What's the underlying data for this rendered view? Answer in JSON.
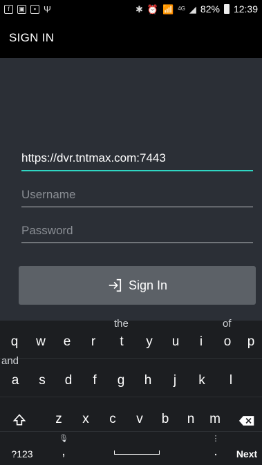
{
  "status_bar": {
    "battery": "82%",
    "time": "12:39",
    "signal_label": "4G"
  },
  "app_bar": {
    "title": "SIGN IN"
  },
  "form": {
    "server_value": "https://dvr.tntmax.com:7443",
    "username_placeholder": "Username",
    "password_placeholder": "Password",
    "signin_label": "Sign In"
  },
  "keyboard": {
    "suggestions": {
      "t": "the",
      "a": "and",
      "o": "of"
    },
    "row1": [
      "q",
      "w",
      "e",
      "r",
      "t",
      "y",
      "u",
      "i",
      "o",
      "p"
    ],
    "row2": [
      "a",
      "s",
      "d",
      "f",
      "g",
      "h",
      "j",
      "k",
      "l"
    ],
    "row3": [
      "z",
      "x",
      "c",
      "v",
      "b",
      "n",
      "m"
    ],
    "sym_label": "?123",
    "comma": ",",
    "period": ".",
    "next_label": "Next",
    "mic_hint": "🎙",
    "more_hint": "⋮"
  }
}
